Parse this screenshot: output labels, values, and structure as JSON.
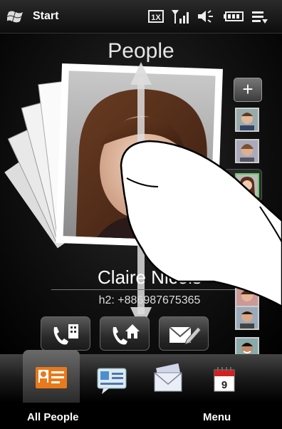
{
  "status_bar": {
    "start_label": "Start",
    "icons": [
      "windows-flag-icon",
      "1x-data-icon",
      "signal-strength-icon",
      "speaker-icon",
      "battery-icon",
      "notification-list-icon"
    ],
    "data_label": "1X"
  },
  "main": {
    "title": "People",
    "contact_name": "Claire Nicols",
    "contact_phone": "h2: +886987675365",
    "actions": [
      {
        "name": "call-office-button",
        "icon": "phone-building-icon"
      },
      {
        "name": "call-home-button",
        "icon": "phone-home-icon"
      },
      {
        "name": "compose-message-button",
        "icon": "envelope-pen-icon"
      }
    ],
    "side_add_label": "+"
  },
  "tabs": [
    {
      "name": "tab-all-people",
      "icon": "contact-card-icon",
      "active": true
    },
    {
      "name": "tab-messaging",
      "icon": "message-bubble-icon",
      "active": false
    },
    {
      "name": "tab-email",
      "icon": "envelopes-icon",
      "active": false
    },
    {
      "name": "tab-calendar",
      "icon": "calendar-icon",
      "active": false,
      "calendar_day": "9"
    }
  ],
  "softkeys": {
    "left": "All People",
    "right": "Menu"
  },
  "colors": {
    "accent_orange": "#e87a1c",
    "calendar_red": "#d22020"
  }
}
